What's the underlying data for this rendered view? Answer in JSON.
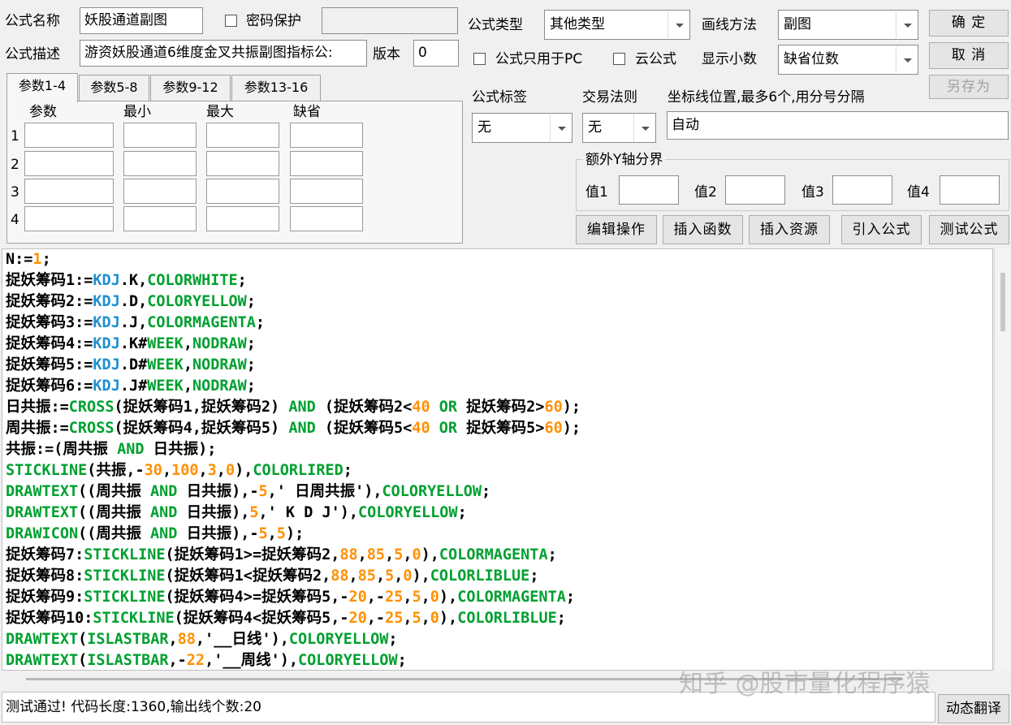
{
  "header": {
    "formula_name_label": "公式名称",
    "formula_name_value": "妖股通道副图",
    "password_label": "密码保护",
    "password_value": "",
    "formula_desc_label": "公式描述",
    "formula_desc_value": "游资妖股通道6维度金叉共振副图指标公:",
    "version_label": "版本",
    "version_value": "0"
  },
  "options": {
    "type_label": "公式类型",
    "type_value": "其他类型",
    "draw_label": "画线方法",
    "draw_value": "副图",
    "pc_only_label": "公式只用于PC",
    "cloud_label": "云公式",
    "decimals_label": "显示小数",
    "decimals_value": "缺省位数",
    "tag_label": "公式标签",
    "tag_value": "无",
    "trade_label": "交易法则",
    "trade_value": "无",
    "axis_label": "坐标线位置,最多6个,用分号分隔",
    "axis_value": "自动",
    "extra_y_label": "额外Y轴分界",
    "y_labels": [
      "值1",
      "值2",
      "值3",
      "值4"
    ]
  },
  "buttons": {
    "ok": "确 定",
    "cancel": "取 消",
    "save_as": "另存为",
    "edit": "编辑操作",
    "insert_func": "插入函数",
    "insert_res": "插入资源",
    "import": "引入公式",
    "test": "测试公式",
    "translate": "动态翻译"
  },
  "params": {
    "tabs": [
      "参数1-4",
      "参数5-8",
      "参数9-12",
      "参数13-16"
    ],
    "headers": [
      "参数",
      "最小",
      "最大",
      "缺省"
    ],
    "rows": [
      "1",
      "2",
      "3",
      "4"
    ]
  },
  "code_lines": [
    [
      [
        "N:=",
        "t"
      ],
      [
        "1",
        "n"
      ],
      [
        ";",
        "t"
      ]
    ],
    [
      [
        "捉妖筹码1:=",
        "t"
      ],
      [
        "KDJ",
        "k"
      ],
      [
        ".K,",
        "t"
      ],
      [
        "COLORWHITE",
        "f"
      ],
      [
        ";",
        "t"
      ]
    ],
    [
      [
        "捉妖筹码2:=",
        "t"
      ],
      [
        "KDJ",
        "k"
      ],
      [
        ".D,",
        "t"
      ],
      [
        "COLORYELLOW",
        "f"
      ],
      [
        ";",
        "t"
      ]
    ],
    [
      [
        "捉妖筹码3:=",
        "t"
      ],
      [
        "KDJ",
        "k"
      ],
      [
        ".J,",
        "t"
      ],
      [
        "COLORMAGENTA",
        "f"
      ],
      [
        ";",
        "t"
      ]
    ],
    [
      [
        "捉妖筹码4:=",
        "t"
      ],
      [
        "KDJ",
        "k"
      ],
      [
        ".K#",
        "t"
      ],
      [
        "WEEK",
        "f"
      ],
      [
        ",",
        "t"
      ],
      [
        "NODRAW",
        "f"
      ],
      [
        ";",
        "t"
      ]
    ],
    [
      [
        "捉妖筹码5:=",
        "t"
      ],
      [
        "KDJ",
        "k"
      ],
      [
        ".D#",
        "t"
      ],
      [
        "WEEK",
        "f"
      ],
      [
        ",",
        "t"
      ],
      [
        "NODRAW",
        "f"
      ],
      [
        ";",
        "t"
      ]
    ],
    [
      [
        "捉妖筹码6:=",
        "t"
      ],
      [
        "KDJ",
        "k"
      ],
      [
        ".J#",
        "t"
      ],
      [
        "WEEK",
        "f"
      ],
      [
        ",",
        "t"
      ],
      [
        "NODRAW",
        "f"
      ],
      [
        ";",
        "t"
      ]
    ],
    [
      [
        "日共振:=",
        "t"
      ],
      [
        "CROSS",
        "f"
      ],
      [
        "(捉妖筹码1,捉妖筹码2) ",
        "t"
      ],
      [
        "AND",
        "f"
      ],
      [
        " (捉妖筹码2<",
        "t"
      ],
      [
        "40",
        "n"
      ],
      [
        " ",
        "t"
      ],
      [
        "OR",
        "f"
      ],
      [
        " 捉妖筹码2>",
        "t"
      ],
      [
        "60",
        "n"
      ],
      [
        ");",
        "t"
      ]
    ],
    [
      [
        "周共振:=",
        "t"
      ],
      [
        "CROSS",
        "f"
      ],
      [
        "(捉妖筹码4,捉妖筹码5) ",
        "t"
      ],
      [
        "AND",
        "f"
      ],
      [
        " (捉妖筹码5<",
        "t"
      ],
      [
        "40",
        "n"
      ],
      [
        " ",
        "t"
      ],
      [
        "OR",
        "f"
      ],
      [
        " 捉妖筹码5>",
        "t"
      ],
      [
        "60",
        "n"
      ],
      [
        ");",
        "t"
      ]
    ],
    [
      [
        "共振:=(周共振 ",
        "t"
      ],
      [
        "AND",
        "f"
      ],
      [
        " 日共振);",
        "t"
      ]
    ],
    [
      [
        "STICKLINE",
        "f"
      ],
      [
        "(共振,-",
        "t"
      ],
      [
        "30",
        "n"
      ],
      [
        ",",
        "t"
      ],
      [
        "100",
        "n"
      ],
      [
        ",",
        "t"
      ],
      [
        "3",
        "n"
      ],
      [
        ",",
        "t"
      ],
      [
        "0",
        "n"
      ],
      [
        "),",
        "t"
      ],
      [
        "COLORLIRED",
        "f"
      ],
      [
        ";",
        "t"
      ]
    ],
    [
      [
        "DRAWTEXT",
        "f"
      ],
      [
        "((周共振 ",
        "t"
      ],
      [
        "AND",
        "f"
      ],
      [
        " 日共振),-",
        "t"
      ],
      [
        "5",
        "n"
      ],
      [
        ",' 日周共振'),",
        "t"
      ],
      [
        "COLORYELLOW",
        "f"
      ],
      [
        ";",
        "t"
      ]
    ],
    [
      [
        "DRAWTEXT",
        "f"
      ],
      [
        "((周共振 ",
        "t"
      ],
      [
        "AND",
        "f"
      ],
      [
        " 日共振),",
        "t"
      ],
      [
        "5",
        "n"
      ],
      [
        ",' K D J'),",
        "t"
      ],
      [
        "COLORYELLOW",
        "f"
      ],
      [
        ";",
        "t"
      ]
    ],
    [
      [
        "DRAWICON",
        "f"
      ],
      [
        "((周共振 ",
        "t"
      ],
      [
        "AND",
        "f"
      ],
      [
        " 日共振),-",
        "t"
      ],
      [
        "5",
        "n"
      ],
      [
        ",",
        "t"
      ],
      [
        "5",
        "n"
      ],
      [
        ");",
        "t"
      ]
    ],
    [
      [
        "捉妖筹码7:",
        "t"
      ],
      [
        "STICKLINE",
        "f"
      ],
      [
        "(捉妖筹码1>=捉妖筹码2,",
        "t"
      ],
      [
        "88",
        "n"
      ],
      [
        ",",
        "t"
      ],
      [
        "85",
        "n"
      ],
      [
        ",",
        "t"
      ],
      [
        "5",
        "n"
      ],
      [
        ",",
        "t"
      ],
      [
        "0",
        "n"
      ],
      [
        "),",
        "t"
      ],
      [
        "COLORMAGENTA",
        "f"
      ],
      [
        ";",
        "t"
      ]
    ],
    [
      [
        "捉妖筹码8:",
        "t"
      ],
      [
        "STICKLINE",
        "f"
      ],
      [
        "(捉妖筹码1<捉妖筹码2,",
        "t"
      ],
      [
        "88",
        "n"
      ],
      [
        ",",
        "t"
      ],
      [
        "85",
        "n"
      ],
      [
        ",",
        "t"
      ],
      [
        "5",
        "n"
      ],
      [
        ",",
        "t"
      ],
      [
        "0",
        "n"
      ],
      [
        "),",
        "t"
      ],
      [
        "COLORLIBLUE",
        "f"
      ],
      [
        ";",
        "t"
      ]
    ],
    [
      [
        "捉妖筹码9:",
        "t"
      ],
      [
        "STICKLINE",
        "f"
      ],
      [
        "(捉妖筹码4>=捉妖筹码5,-",
        "t"
      ],
      [
        "20",
        "n"
      ],
      [
        ",-",
        "t"
      ],
      [
        "25",
        "n"
      ],
      [
        ",",
        "t"
      ],
      [
        "5",
        "n"
      ],
      [
        ",",
        "t"
      ],
      [
        "0",
        "n"
      ],
      [
        "),",
        "t"
      ],
      [
        "COLORMAGENTA",
        "f"
      ],
      [
        ";",
        "t"
      ]
    ],
    [
      [
        "捉妖筹码10:",
        "t"
      ],
      [
        "STICKLINE",
        "f"
      ],
      [
        "(捉妖筹码4<捉妖筹码5,-",
        "t"
      ],
      [
        "20",
        "n"
      ],
      [
        ",-",
        "t"
      ],
      [
        "25",
        "n"
      ],
      [
        ",",
        "t"
      ],
      [
        "5",
        "n"
      ],
      [
        ",",
        "t"
      ],
      [
        "0",
        "n"
      ],
      [
        "),",
        "t"
      ],
      [
        "COLORLIBLUE",
        "f"
      ],
      [
        ";",
        "t"
      ]
    ],
    [
      [
        "DRAWTEXT",
        "f"
      ],
      [
        "(",
        "t"
      ],
      [
        "ISLASTBAR",
        "f"
      ],
      [
        ",",
        "t"
      ],
      [
        "88",
        "n"
      ],
      [
        ",'__日线'),",
        "t"
      ],
      [
        "COLORYELLOW",
        "f"
      ],
      [
        ";",
        "t"
      ]
    ],
    [
      [
        "DRAWTEXT",
        "f"
      ],
      [
        "(",
        "t"
      ],
      [
        "ISLASTBAR",
        "f"
      ],
      [
        ",-",
        "t"
      ],
      [
        "22",
        "n"
      ],
      [
        ",'__周线'),",
        "t"
      ],
      [
        "COLORYELLOW",
        "f"
      ],
      [
        ";",
        "t"
      ]
    ]
  ],
  "status_text": "测试通过! 代码长度:1360,输出线个数:20",
  "watermark": "知乎 @股市量化程序猿"
}
